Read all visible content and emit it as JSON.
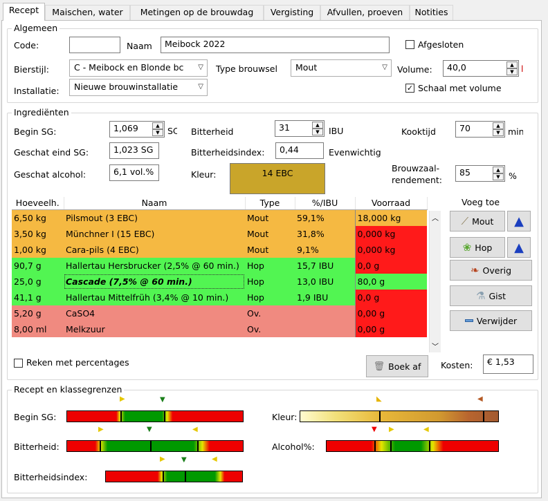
{
  "tabs": [
    {
      "label": "Recept",
      "active": true
    },
    {
      "label": "Maischen, water"
    },
    {
      "label": "Metingen op de brouwdag"
    },
    {
      "label": "Vergisting"
    },
    {
      "label": "Afvullen, proeven"
    },
    {
      "label": "Notities"
    }
  ],
  "algemeen": {
    "title": "Algemeen",
    "code_label": "Code:",
    "code_value": "",
    "naam_label": "Naam",
    "naam_value": "Meibock 2022",
    "afgesloten_label": "Afgesloten",
    "bierstijl_label": "Bierstijl:",
    "bierstijl_value": "C - Meibock en Blonde bc",
    "type_label": "Type brouwsel",
    "type_value": "Mout",
    "volume_label": "Volume:",
    "volume_value": "40,0",
    "volume_unit": "l",
    "installatie_label": "Installatie:",
    "installatie_value": "Nieuwe brouwinstallatie",
    "schaal_label": "Schaal met volume"
  },
  "ingredienten": {
    "title": "Ingrediënten",
    "begin_sg_label": "Begin SG:",
    "begin_sg_value": "1,069",
    "begin_sg_unit": "SC",
    "bitterheid_label": "Bitterheid",
    "bitterheid_value": "31",
    "bitterheid_unit": "IBU",
    "kooktijd_label": "Kooktijd",
    "kooktijd_value": "70",
    "kooktijd_unit": "min",
    "eind_sg_label": "Geschat eind SG:",
    "eind_sg_value": "1,023 SG",
    "bitterindex_label": "Bitterheidsindex:",
    "bitterindex_value": "0,44",
    "bitterindex_text": "Evenwichtig",
    "alcohol_label": "Geschat alcohol:",
    "alcohol_value": "6,1 vol.%",
    "kleur_label": "Kleur:",
    "kleur_value": "14 EBC",
    "kleur_color": "#c9a52a",
    "rendement_label": "Brouwzaal-\nrendement:",
    "rendement_value": "85",
    "rendement_unit": "%",
    "headers": [
      "Hoeveelh.",
      "Naam",
      "Type",
      "%/IBU",
      "Voorraad"
    ],
    "rows": [
      {
        "q": "6,50 kg",
        "n": "Pilsmout (3 EBC)",
        "t": "Mout",
        "p": "59,1%",
        "v": "18,000 kg",
        "bg": "#f5b942",
        "vbg": "#f5b942"
      },
      {
        "q": "3,50 kg",
        "n": "Münchner I (15 EBC)",
        "t": "Mout",
        "p": "31,8%",
        "v": "0,000 kg",
        "bg": "#f5b942",
        "vbg": "#ff1a1a"
      },
      {
        "q": "1,00 kg",
        "n": "Cara-pils (4 EBC)",
        "t": "Mout",
        "p": "9,1%",
        "v": "0,000 kg",
        "bg": "#f5b942",
        "vbg": "#ff1a1a"
      },
      {
        "q": "90,7 g",
        "n": "Hallertau Hersbrucker (2,5% @ 60 min.)",
        "t": "Hop",
        "p": "15,7 IBU",
        "v": "0,0 g",
        "bg": "#52f552",
        "vbg": "#ff1a1a"
      },
      {
        "q": "25,0 g",
        "n": "Cascade (7,5% @ 60 min.)",
        "t": "Hop",
        "p": "13,0 IBU",
        "v": "80,0 g",
        "bg": "#52f552",
        "vbg": "#52f552",
        "sel": true
      },
      {
        "q": "41,1 g",
        "n": "Hallertau Mittelfrüh (3,4% @ 10 min.)",
        "t": "Hop",
        "p": "1,9 IBU",
        "v": "0,0 g",
        "bg": "#52f552",
        "vbg": "#ff1a1a"
      },
      {
        "q": "5,20 g",
        "n": "CaSO4",
        "t": "Ov.",
        "p": "",
        "v": "0,00 g",
        "bg": "#f08a80",
        "vbg": "#ff1a1a"
      },
      {
        "q": "8,00 ml",
        "n": "Melkzuur",
        "t": "Ov.",
        "p": "",
        "v": "0,00 g",
        "bg": "#f08a80",
        "vbg": "#ff1a1a"
      }
    ],
    "voeg_toe": "Voeg toe",
    "btn_mout": "Mout",
    "btn_hop": "Hop",
    "btn_overig": "Overig",
    "btn_gist": "Gist",
    "btn_verwijder": "Verwijder",
    "percentages_label": "Reken met percentages",
    "boek_af": "Boek af",
    "kosten_label": "Kosten:",
    "kosten_value": "€ 1,53"
  },
  "klasse": {
    "title": "Recept en klassegrenzen",
    "begin_sg": "Begin SG:",
    "bitterheid": "Bitterheid:",
    "bitterindex": "Bitterheidsindex:",
    "kleur": "Kleur:",
    "alcohol": "Alcohol%:"
  }
}
